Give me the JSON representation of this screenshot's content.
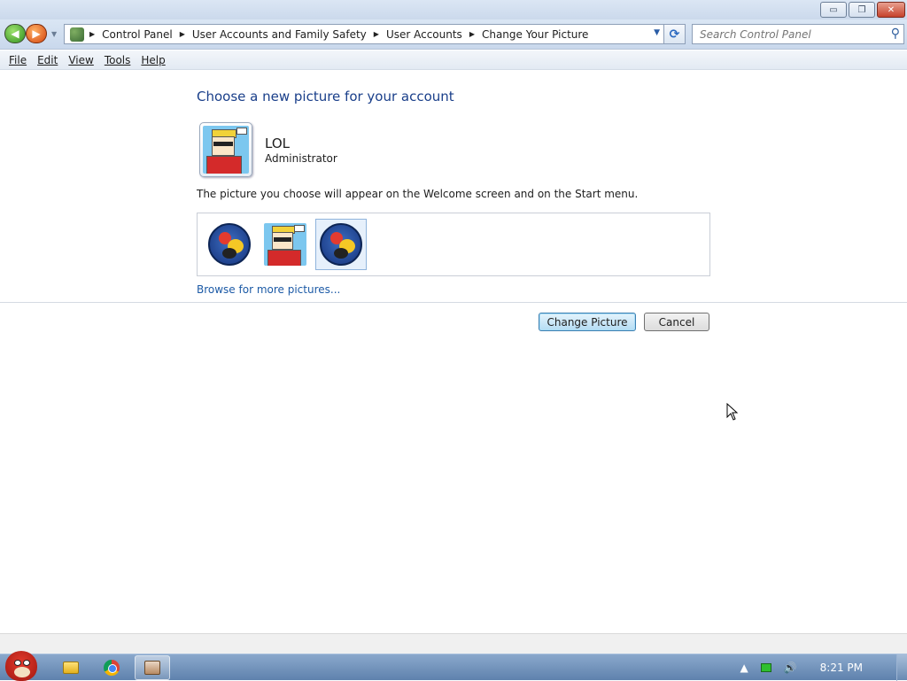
{
  "window": {
    "caption_buttons": {
      "minimize": "▭",
      "maximize": "❐",
      "close": "✕"
    }
  },
  "nav": {
    "back_icon": "◀",
    "forward_icon": "▶",
    "breadcrumbs": [
      "Control Panel",
      "User Accounts and Family Safety",
      "User Accounts",
      "Change Your Picture"
    ],
    "search_placeholder": "Search Control Panel"
  },
  "menu": {
    "items": [
      "File",
      "Edit",
      "View",
      "Tools",
      "Help"
    ]
  },
  "main": {
    "heading": "Choose a new picture for your account",
    "user_name": "LOL",
    "user_role": "Administrator",
    "description": "The picture you choose will appear on the Welcome screen and on the Start menu.",
    "pictures": [
      {
        "name": "angry-birds-group-picture",
        "selected": false
      },
      {
        "name": "sunglasses-man-picture",
        "selected": false
      },
      {
        "name": "angry-birds-group-picture",
        "selected": true
      }
    ],
    "browse_link": "Browse for more pictures...",
    "change_button": "Change Picture",
    "cancel_button": "Cancel"
  },
  "taskbar": {
    "clock": "8:21 PM"
  },
  "colors": {
    "heading": "#1a3f8a",
    "link": "#1c5aa6",
    "taskbar": "#5f82ad"
  }
}
